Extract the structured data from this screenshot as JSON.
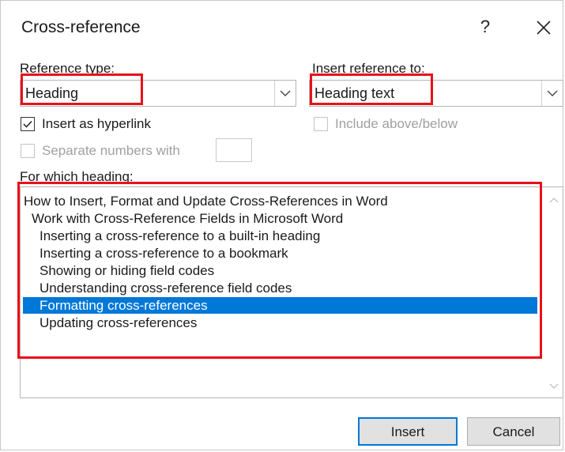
{
  "dialog": {
    "title": "Cross-reference",
    "help_label": "?",
    "close_icon": "close-icon"
  },
  "reference_type": {
    "label": "Reference type:",
    "value": "Heading"
  },
  "insert_reference_to": {
    "label": "Insert reference to:",
    "value": "Heading text"
  },
  "options": {
    "insert_as_hyperlink": {
      "label": "Insert as hyperlink",
      "checked": true
    },
    "include_above_below": {
      "label": "Include above/below",
      "checked": false,
      "disabled": true
    },
    "separate_numbers": {
      "label": "Separate numbers with",
      "checked": false,
      "disabled": true,
      "value": ""
    }
  },
  "heading_list": {
    "label": "For which heading:",
    "items": [
      "How to Insert, Format and Update Cross-References in Word",
      "Work with Cross-Reference Fields in Microsoft Word",
      "Inserting a cross-reference to a built-in heading",
      "Inserting a cross-reference to a bookmark",
      "Showing or hiding field codes",
      "Understanding cross-reference field codes",
      "Formatting cross-references",
      "Updating cross-references"
    ],
    "selected": "Formatting cross-references"
  },
  "buttons": {
    "insert": "Insert",
    "cancel": "Cancel"
  },
  "colors": {
    "selection": "#0078d7",
    "highlight": "#e8101a"
  }
}
